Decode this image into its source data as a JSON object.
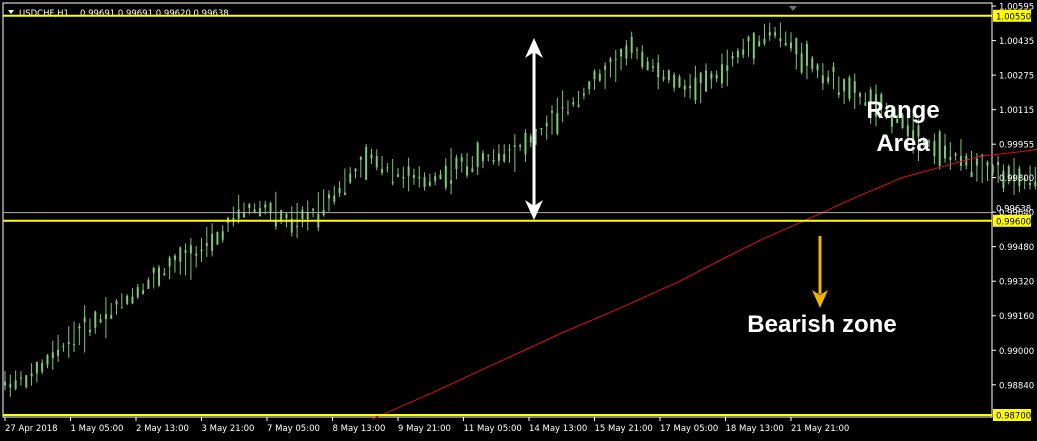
{
  "header": {
    "symbol": "USDCHF,H1",
    "ohlc": "0.99691 0.99691 0.99620 0.99638"
  },
  "annotations": {
    "range_line1": "Range",
    "range_line2": "Area",
    "bearish": "Bearish zone"
  },
  "colors": {
    "background": "#000000",
    "candle": "#7fc77a",
    "moving_average": "#e01010",
    "support_resistance": "#ffff00",
    "bid_line": "#b0b0b0",
    "arrow_white": "#ffffff",
    "arrow_yellow": "#f0b400",
    "axis": "#ffffff"
  },
  "chart_data": {
    "type": "candlestick",
    "symbol": "USDCHF",
    "timeframe": "H1",
    "ylim": [
      0.987,
      1.006
    ],
    "y_ticks": [
      "1.00595",
      "1.00435",
      "1.00275",
      "1.00115",
      "0.99955",
      "0.99800",
      "0.99640",
      "0.99480",
      "0.99320",
      "0.99160",
      "0.99000",
      "0.98840"
    ],
    "x_ticks": [
      "27 Apr 2018",
      "1 May 05:00",
      "2 May 13:00",
      "3 May 21:00",
      "7 May 05:00",
      "8 May 13:00",
      "9 May 21:00",
      "11 May 05:00",
      "14 May 13:00",
      "15 May 21:00",
      "17 May 05:00",
      "18 May 13:00",
      "21 May 21:00"
    ],
    "levels": [
      {
        "label": "1.00550",
        "value": 1.0055
      },
      {
        "label": "0.99600",
        "value": 0.996
      },
      {
        "label": "0.98700",
        "value": 0.987
      }
    ],
    "current_price": {
      "label": "0.99638",
      "value": 0.99638
    },
    "price_path": [
      [
        0,
        0.9885
      ],
      [
        0.4,
        0.9887
      ],
      [
        1,
        0.9905
      ],
      [
        1.7,
        0.992
      ],
      [
        2.5,
        0.9938
      ],
      [
        3.2,
        0.995
      ],
      [
        3.6,
        0.9965
      ],
      [
        4,
        0.9966
      ],
      [
        4.4,
        0.9958
      ],
      [
        4.8,
        0.9966
      ],
      [
        5.2,
        0.9978
      ],
      [
        5.6,
        0.9989
      ],
      [
        6,
        0.9982
      ],
      [
        6.4,
        0.9978
      ],
      [
        7,
        0.9986
      ],
      [
        7.5,
        0.999
      ],
      [
        8,
        0.9996
      ],
      [
        8.5,
        1.001
      ],
      [
        9.2,
        1.003
      ],
      [
        9.6,
        1.004
      ],
      [
        10,
        1.0028
      ],
      [
        10.4,
        1.0022
      ],
      [
        10.8,
        1.0025
      ],
      [
        11.3,
        1.004
      ],
      [
        11.7,
        1.0048
      ],
      [
        12,
        1.0042
      ],
      [
        12.4,
        1.003
      ],
      [
        13,
        1.0018
      ],
      [
        13.5,
        1.001
      ],
      [
        14,
        0.9998
      ],
      [
        14.6,
        0.9988
      ],
      [
        15,
        0.9985
      ],
      [
        15.5,
        0.9978
      ],
      [
        16,
        0.998
      ],
      [
        16.5,
        1.0
      ],
      [
        17,
        1.001
      ],
      [
        17.6,
        1.0018
      ],
      [
        18,
        1.001
      ],
      [
        18.4,
        1.0
      ],
      [
        18.8,
        0.999
      ],
      [
        19.3,
        0.9995
      ],
      [
        19.7,
        0.9985
      ],
      [
        20.2,
        0.998
      ],
      [
        20.7,
        0.997
      ],
      [
        21,
        0.9972
      ]
    ],
    "moving_average_path": [
      [
        5.6,
        0.9868
      ],
      [
        6.5,
        0.988
      ],
      [
        7.5,
        0.9894
      ],
      [
        8.5,
        0.9908
      ],
      [
        9.5,
        0.9921
      ],
      [
        10.3,
        0.9932
      ],
      [
        11,
        0.9943
      ],
      [
        11.6,
        0.9952
      ],
      [
        12.2,
        0.996
      ],
      [
        13,
        0.9971
      ],
      [
        13.7,
        0.998
      ],
      [
        14.3,
        0.9985
      ],
      [
        14.9,
        0.999
      ],
      [
        15.5,
        0.9992
      ],
      [
        16.2,
        0.9995
      ],
      [
        17,
        0.9997
      ],
      [
        17.8,
        0.9998
      ],
      [
        18.5,
        1.0
      ],
      [
        19.3,
        1.0001
      ],
      [
        19.9,
        0.9998
      ],
      [
        20.5,
        0.9996
      ],
      [
        21,
        0.9994
      ]
    ]
  }
}
